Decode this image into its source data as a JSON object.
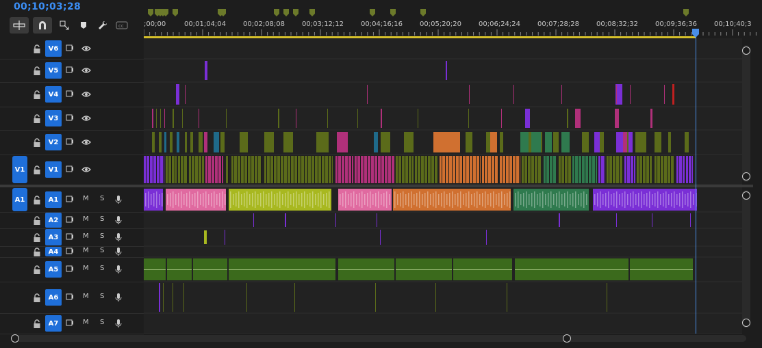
{
  "playhead_timecode": "00;10;03;28",
  "ruler": {
    "labels": [
      ";00;00",
      "00;01;04;04",
      "00;02;08;08",
      "00;03;12;12",
      "00;04;16;16",
      "00;05;20;20",
      "00;06;24;24",
      "00;07;28;28",
      "00;08;32;32",
      "00;09;36;36",
      "00;10;40;3"
    ]
  },
  "toolbar": {
    "tools": [
      "insert-sequence-nest-icon",
      "snap-magnet-icon",
      "linked-selection-icon",
      "add-marker-icon",
      "wrench-settings-icon",
      "captions-icon"
    ]
  },
  "video_tracks": [
    {
      "name": "V6",
      "source": ""
    },
    {
      "name": "V5",
      "source": ""
    },
    {
      "name": "V4",
      "source": ""
    },
    {
      "name": "V3",
      "source": ""
    },
    {
      "name": "V2",
      "source": ""
    },
    {
      "name": "V1",
      "source": "V1"
    }
  ],
  "audio_tracks": [
    {
      "name": "A1",
      "source": "A1",
      "m": "M",
      "s": "S"
    },
    {
      "name": "A2",
      "source": "",
      "m": "M",
      "s": "S"
    },
    {
      "name": "A3",
      "source": "",
      "m": "M",
      "s": "S"
    },
    {
      "name": "A4",
      "source": "",
      "m": "M",
      "s": "S"
    },
    {
      "name": "A5",
      "source": "",
      "m": "M",
      "s": "S"
    },
    {
      "name": "A6",
      "source": "",
      "m": "M",
      "s": "S"
    },
    {
      "name": "A7",
      "source": "",
      "m": "M",
      "s": "S"
    }
  ],
  "colors": {
    "accent": "#1f6fd9",
    "timecode": "#3b8ef5",
    "work_area": "#d6c12b",
    "clip_olive": "#5b6b1a",
    "clip_purple": "#7a2fd6",
    "clip_magenta": "#b0307a",
    "clip_pink": "#e06aa0",
    "clip_orange": "#d07030",
    "clip_green": "#2f7a4e",
    "clip_lime": "#a8b820",
    "clip_teal": "#1f6a8a",
    "clip_audio_green": "#3b6a1c"
  }
}
